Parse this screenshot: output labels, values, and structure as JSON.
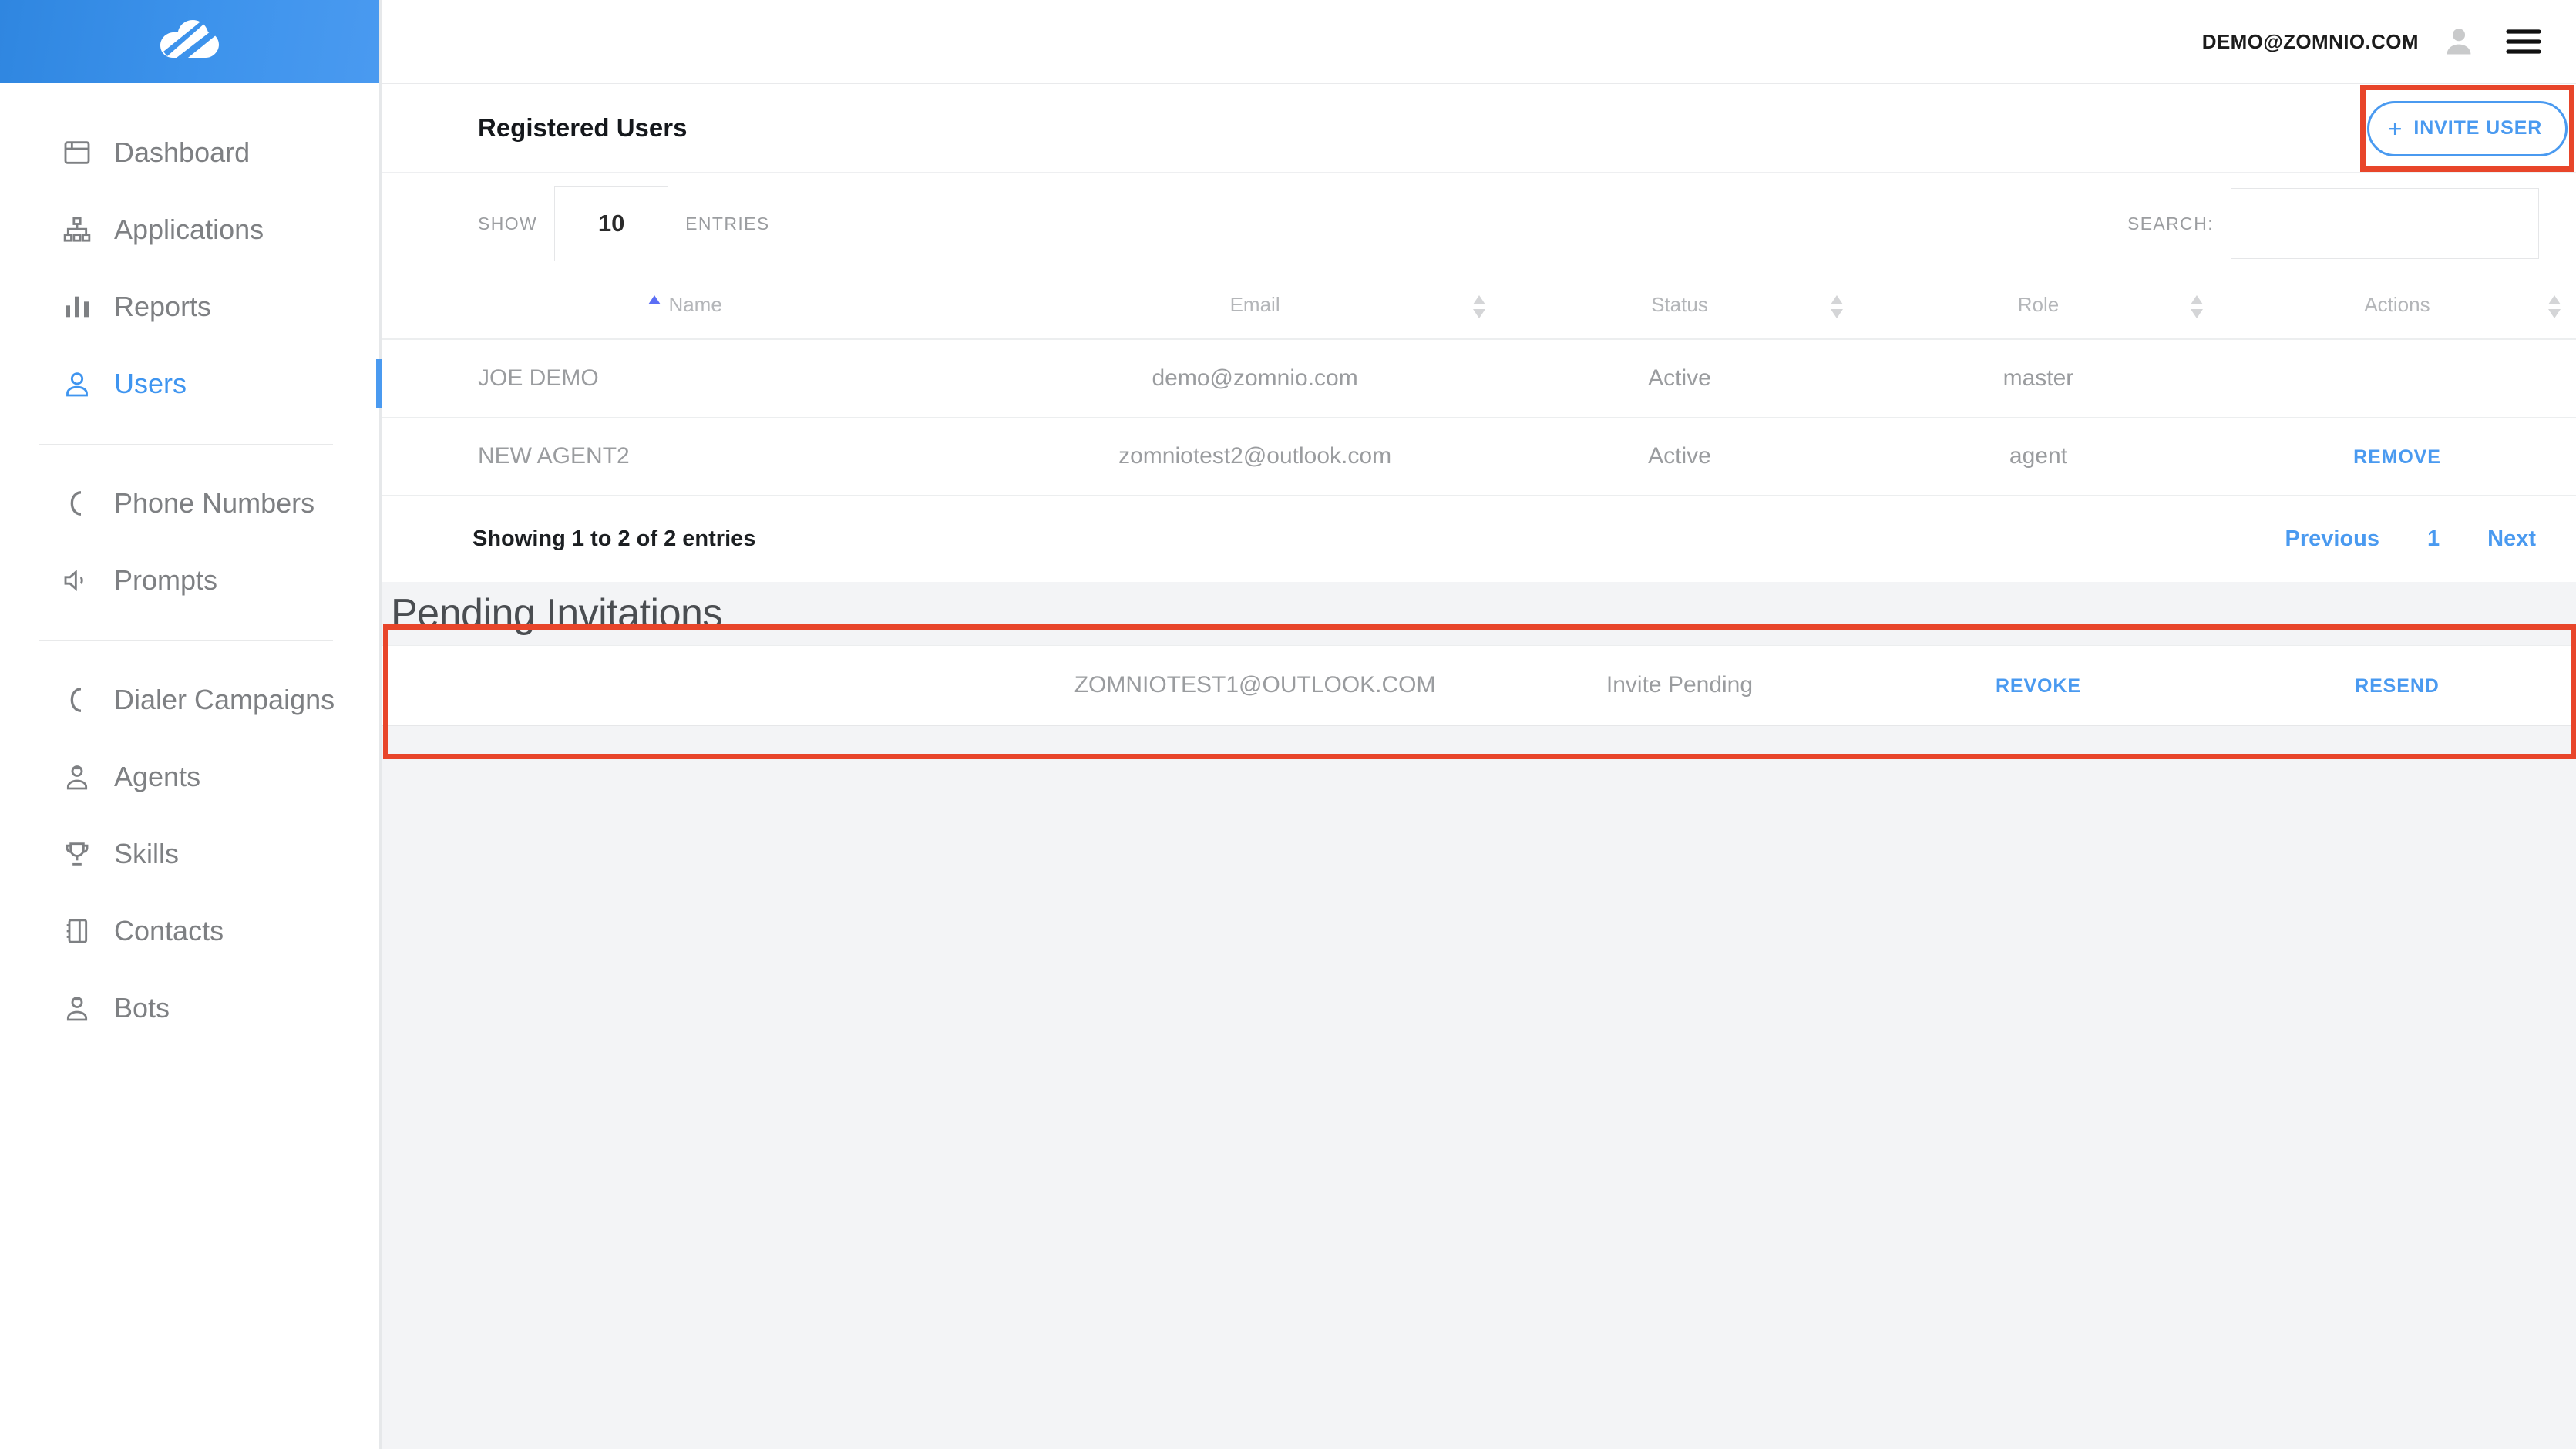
{
  "brand": {
    "logo_icon": "cloud-swoosh-logo",
    "header_color": "#3d93ec",
    "accent_color": "#4a9af0",
    "highlight_color": "#e8452a"
  },
  "sidebar": {
    "items": [
      {
        "label": "Dashboard",
        "icon": "window-icon",
        "active": false
      },
      {
        "label": "Applications",
        "icon": "sitemap-icon",
        "active": false
      },
      {
        "label": "Reports",
        "icon": "bar-chart-icon",
        "active": false
      },
      {
        "label": "Users",
        "icon": "user-icon",
        "active": true
      },
      {
        "label": "Phone Numbers",
        "icon": "phone-icon",
        "active": false
      },
      {
        "label": "Prompts",
        "icon": "speaker-icon",
        "active": false
      },
      {
        "label": "Dialer Campaigns",
        "icon": "phone-icon",
        "active": false
      },
      {
        "label": "Agents",
        "icon": "agent-user-icon",
        "active": false
      },
      {
        "label": "Skills",
        "icon": "trophy-icon",
        "active": false
      },
      {
        "label": "Contacts",
        "icon": "address-book-icon",
        "active": false
      },
      {
        "label": "Bots",
        "icon": "bot-user-icon",
        "active": false
      }
    ]
  },
  "topbar": {
    "user_email": "DEMO@ZOMNIO.COM",
    "avatar_icon": "avatar-icon",
    "menu_icon": "hamburger-icon"
  },
  "card": {
    "title": "Registered Users",
    "invite_button": {
      "label": "INVITE USER",
      "plus": "+"
    }
  },
  "controls": {
    "show_label": "SHOW",
    "entries_value": "10",
    "entries_label": "ENTRIES",
    "search_label": "SEARCH:",
    "search_value": "",
    "search_placeholder": ""
  },
  "table": {
    "columns": [
      {
        "label": "Name",
        "sort": "asc"
      },
      {
        "label": "Email",
        "sort": "none"
      },
      {
        "label": "Status",
        "sort": "none"
      },
      {
        "label": "Role",
        "sort": "none"
      },
      {
        "label": "Actions",
        "sort": "none"
      }
    ],
    "rows": [
      {
        "name": "JOE DEMO",
        "email": "demo@zomnio.com",
        "status": "Active",
        "role": "master",
        "action": ""
      },
      {
        "name": "NEW AGENT2",
        "email": "zomniotest2@outlook.com",
        "status": "Active",
        "role": "agent",
        "action": "REMOVE"
      }
    ],
    "footer": {
      "info": "Showing 1 to 2 of 2 entries",
      "previous": "Previous",
      "page": "1",
      "next": "Next"
    }
  },
  "pending": {
    "title": "Pending Invitations",
    "rows": [
      {
        "name": "",
        "email": "ZOMNIOTEST1@OUTLOOK.COM",
        "status": "Invite Pending",
        "revoke": "REVOKE",
        "resend": "RESEND"
      }
    ]
  }
}
